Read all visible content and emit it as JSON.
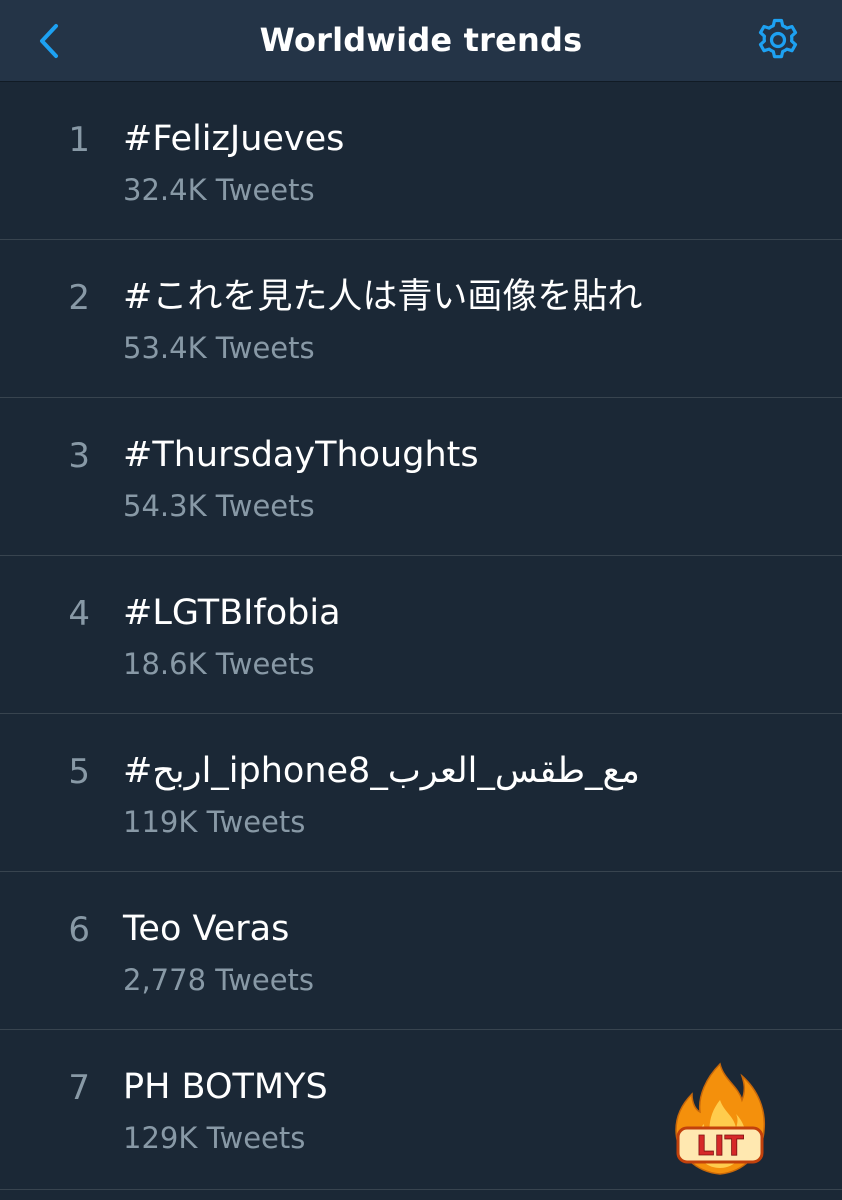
{
  "header": {
    "title": "Worldwide trends",
    "back_icon": "chevron-left-icon",
    "settings_icon": "gear-icon",
    "accent_color": "#1da1f2"
  },
  "trends": [
    {
      "rank": "1",
      "name": "#FelizJueves",
      "count": "32.4K Tweets"
    },
    {
      "rank": "2",
      "name": "#これを見た人は青い画像を貼れ",
      "count": "53.4K Tweets"
    },
    {
      "rank": "3",
      "name": "#ThursdayThoughts",
      "count": "54.3K Tweets"
    },
    {
      "rank": "4",
      "name": "#LGTBIfobia",
      "count": "18.6K Tweets"
    },
    {
      "rank": "5",
      "name": "#اربح_iphone8_مع_طقس_العرب",
      "count": "119K Tweets"
    },
    {
      "rank": "6",
      "name": "Teo Veras",
      "count": "2,778 Tweets"
    },
    {
      "rank": "7",
      "name": "PH BOTMYS",
      "count": "129K Tweets"
    }
  ],
  "sticker": {
    "icon": "fire-icon",
    "text": "LIT"
  },
  "colors": {
    "background": "#1b2836",
    "header_background": "#243447",
    "primary_text": "#ffffff",
    "secondary_text": "#8899a6",
    "divider": "#38444f"
  }
}
